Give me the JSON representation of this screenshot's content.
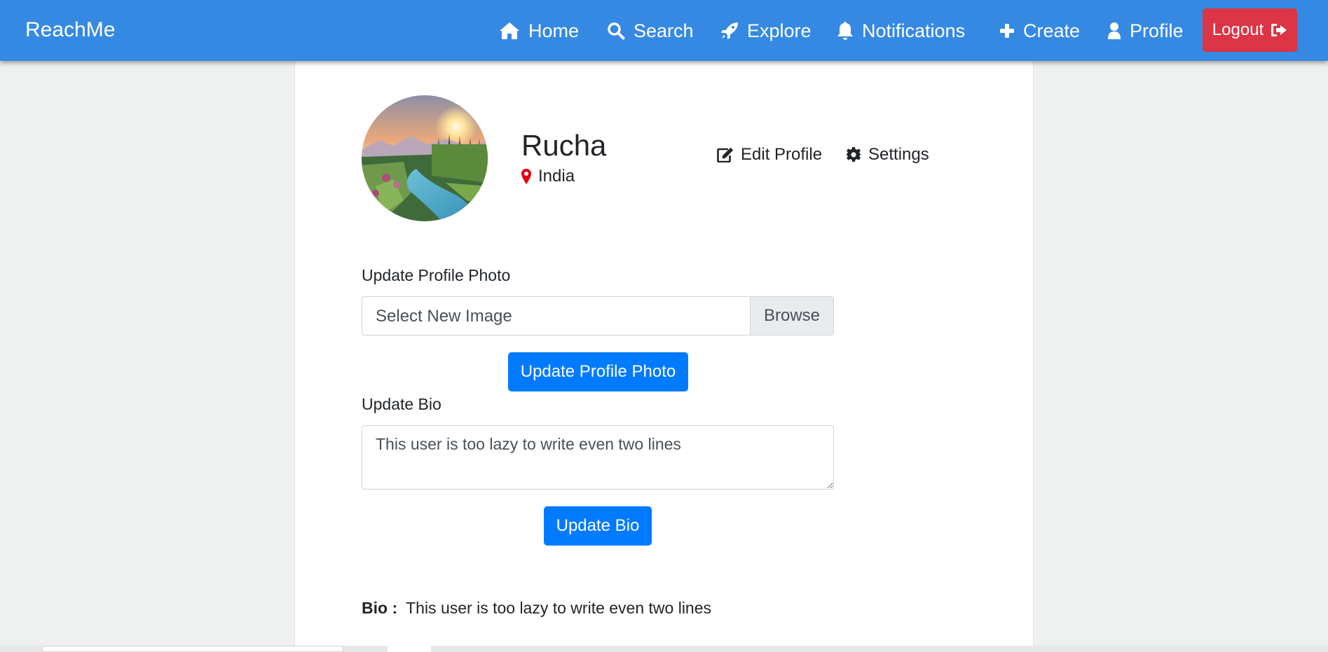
{
  "navbar": {
    "brand": "ReachMe",
    "items": [
      {
        "label": "Home",
        "icon": "home-icon"
      },
      {
        "label": "Search",
        "icon": "search-icon"
      },
      {
        "label": "Explore",
        "icon": "rocket-icon"
      },
      {
        "label": "Notifications",
        "icon": "bell-icon"
      },
      {
        "label": "Create",
        "icon": "plus-icon"
      },
      {
        "label": "Profile",
        "icon": "user-icon"
      }
    ],
    "logout_label": "Logout",
    "logout_icon": "sign-out-icon"
  },
  "profile": {
    "name": "Rucha",
    "location": "India",
    "location_icon": "map-marker-icon",
    "edit_profile_label": "Edit Profile",
    "settings_label": "Settings"
  },
  "photo_form": {
    "label": "Update Profile Photo",
    "file_placeholder": "Select New Image",
    "browse_label": "Browse",
    "submit_label": "Update Profile Photo"
  },
  "bio_form": {
    "label": "Update Bio",
    "textarea_value": "This user is too lazy to write even two lines",
    "submit_label": "Update Bio"
  },
  "bio_display": {
    "label": "Bio :",
    "text": "This user is too lazy to write even two lines"
  },
  "colors": {
    "navbar": "#3589e3",
    "logout": "#dc3545",
    "primary_button": "#007bff",
    "location_pin": "#e3000f",
    "page_background": "#eff1f0"
  }
}
